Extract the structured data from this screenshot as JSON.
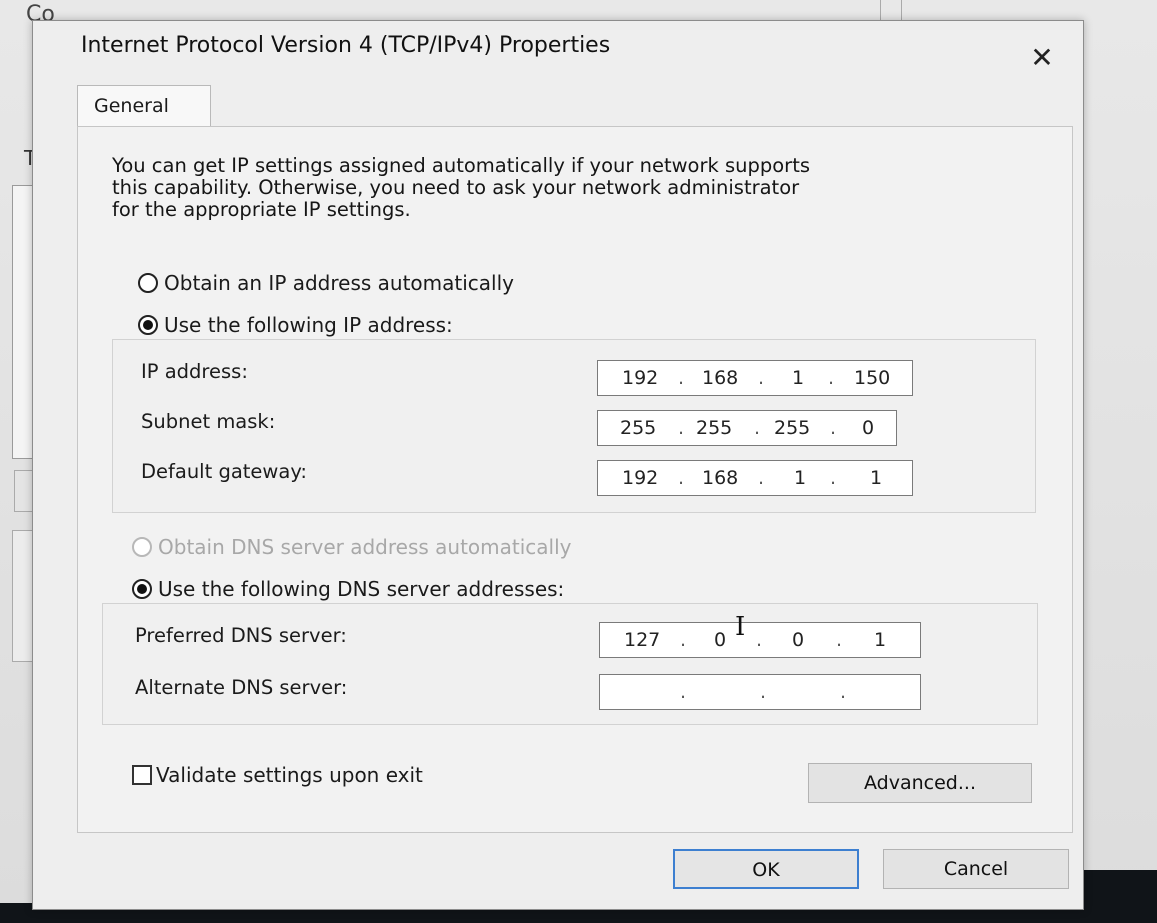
{
  "background": {
    "title_fragment": "Co",
    "label_fragment": "Th"
  },
  "dialog": {
    "title": "Internet Protocol Version 4 (TCP/IPv4) Properties",
    "close_glyph": "✕",
    "tab_general": "General",
    "description_line1": "You can get IP settings assigned automatically if your network supports",
    "description_line2": "this capability. Otherwise, you need to ask your network administrator",
    "description_line3": "for the appropriate IP settings.",
    "radio_ip_auto": "Obtain an IP address automatically",
    "radio_ip_manual": "Use the following IP address:",
    "ip_selected": "manual",
    "ip_address_label": "IP address:",
    "ip_address": [
      "192",
      "168",
      "1",
      "150"
    ],
    "subnet_label": "Subnet mask:",
    "subnet_mask": [
      "255",
      "255",
      "255",
      "0"
    ],
    "gateway_label": "Default gateway:",
    "gateway": [
      "192",
      "168",
      "1",
      "1"
    ],
    "radio_dns_auto": "Obtain DNS server address automatically",
    "radio_dns_manual": "Use the following DNS server addresses:",
    "dns_selected": "manual",
    "preferred_dns_label": "Preferred DNS server:",
    "preferred_dns": [
      "127",
      "0",
      "0",
      "1"
    ],
    "alternate_dns_label": "Alternate DNS server:",
    "alternate_dns": [
      "",
      "",
      "",
      ""
    ],
    "dot": ".",
    "validate_label": "Validate settings upon exit",
    "validate_checked": false,
    "advanced_button": "Advanced...",
    "ok_button": "OK",
    "cancel_button": "Cancel"
  },
  "colors": {
    "dialog_bg": "#eeeeee",
    "default_button_border": "#3d7fd0",
    "disabled_text": "#a8a8a8"
  }
}
